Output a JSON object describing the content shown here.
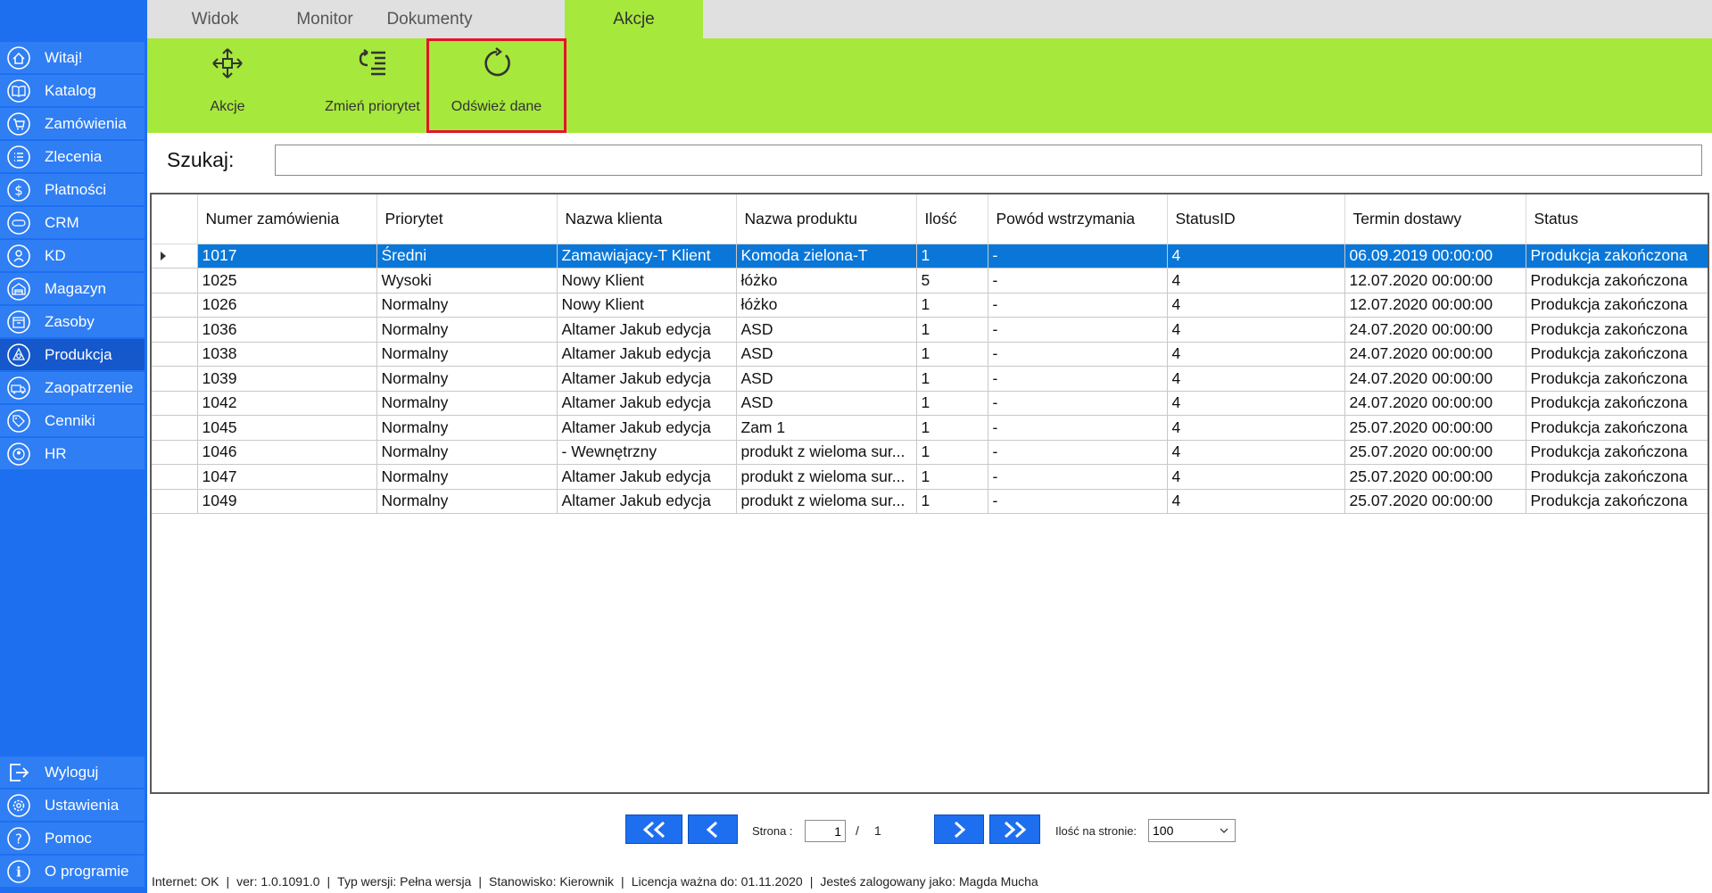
{
  "sidebar": {
    "items": [
      {
        "label": "Witaj!",
        "icon": "home-icon"
      },
      {
        "label": "Katalog",
        "icon": "book-icon"
      },
      {
        "label": "Zamówienia",
        "icon": "cart-icon"
      },
      {
        "label": "Zlecenia",
        "icon": "list-icon"
      },
      {
        "label": "Płatności",
        "icon": "dollar-icon"
      },
      {
        "label": "CRM",
        "icon": "crm-icon"
      },
      {
        "label": "KD",
        "icon": "person-icon"
      },
      {
        "label": "Magazyn",
        "icon": "warehouse-icon"
      },
      {
        "label": "Zasoby",
        "icon": "box-icon"
      },
      {
        "label": "Produkcja",
        "icon": "production-icon"
      },
      {
        "label": "Zaopatrzenie",
        "icon": "truck-icon"
      },
      {
        "label": "Cenniki",
        "icon": "tag-icon"
      },
      {
        "label": "HR",
        "icon": "hr-icon"
      }
    ],
    "active_item": "Produkcja",
    "bottom_items": [
      {
        "label": "Wyloguj",
        "icon": "logout-icon"
      },
      {
        "label": "Ustawienia",
        "icon": "settings-icon"
      },
      {
        "label": "Pomoc",
        "icon": "help-icon"
      },
      {
        "label": "O programie",
        "icon": "info-icon"
      }
    ]
  },
  "tabs": [
    {
      "label": "Widok"
    },
    {
      "label": "Monitor"
    },
    {
      "label": "Dokumenty"
    },
    {
      "label": "Akcje"
    }
  ],
  "active_tab": "Akcje",
  "ribbon": {
    "actions_label": "Akcje",
    "priority_label": "Zmień priorytet",
    "refresh_label": "Odśwież dane"
  },
  "search": {
    "label": "Szukaj:",
    "value": ""
  },
  "table": {
    "columns": [
      "Numer zamówienia",
      "Priorytet",
      "Nazwa klienta",
      "Nazwa produktu",
      "Ilość",
      "Powód wstrzymania",
      "StatusID",
      "Termin dostawy",
      "Status"
    ],
    "rows": [
      [
        "1017",
        "Średni",
        "Zamawiajacy-T Klient",
        "Komoda zielona-T",
        "1",
        "-",
        "4",
        "06.09.2019 00:00:00",
        "Produkcja zakończona"
      ],
      [
        "1025",
        "Wysoki",
        "Nowy Klient",
        "łóżko",
        "5",
        "-",
        "4",
        "12.07.2020 00:00:00",
        "Produkcja zakończona"
      ],
      [
        "1026",
        "Normalny",
        "Nowy Klient",
        "łóżko",
        "1",
        "-",
        "4",
        "12.07.2020 00:00:00",
        "Produkcja zakończona"
      ],
      [
        "1036",
        "Normalny",
        "Altamer Jakub edycja",
        "ASD",
        "1",
        "-",
        "4",
        "24.07.2020 00:00:00",
        "Produkcja zakończona"
      ],
      [
        "1038",
        "Normalny",
        "Altamer Jakub edycja",
        "ASD",
        "1",
        "-",
        "4",
        "24.07.2020 00:00:00",
        "Produkcja zakończona"
      ],
      [
        "1039",
        "Normalny",
        "Altamer Jakub edycja",
        "ASD",
        "1",
        "-",
        "4",
        "24.07.2020 00:00:00",
        "Produkcja zakończona"
      ],
      [
        "1042",
        "Normalny",
        "Altamer Jakub edycja",
        "ASD",
        "1",
        "-",
        "4",
        "24.07.2020 00:00:00",
        "Produkcja zakończona"
      ],
      [
        "1045",
        "Normalny",
        "Altamer Jakub edycja",
        "Zam 1",
        "1",
        "-",
        "4",
        "25.07.2020 00:00:00",
        "Produkcja zakończona"
      ],
      [
        "1046",
        "Normalny",
        "- Wewnętrzny",
        "produkt z wieloma sur...",
        "1",
        "-",
        "4",
        "25.07.2020 00:00:00",
        "Produkcja zakończona"
      ],
      [
        "1047",
        "Normalny",
        "Altamer Jakub edycja",
        "produkt z wieloma sur...",
        "1",
        "-",
        "4",
        "25.07.2020 00:00:00",
        "Produkcja zakończona"
      ],
      [
        "1049",
        "Normalny",
        "Altamer Jakub edycja",
        "produkt z wieloma sur...",
        "1",
        "-",
        "4",
        "25.07.2020 00:00:00",
        "Produkcja zakończona"
      ]
    ],
    "selected_row": 0
  },
  "pager": {
    "page_label": "Strona :",
    "current_page": "1",
    "separator": "/",
    "total_pages": "1",
    "per_page_label": "Ilość na stronie:",
    "per_page_value": "100"
  },
  "status_bar": {
    "internet": "Internet: OK",
    "version": "ver: 1.0.1091.0",
    "version_type": "Typ wersji: Pełna wersja",
    "position": "Stanowisko: Kierownik",
    "license": "Licencja ważna do: 01.11.2020",
    "user": "Jesteś zalogowany jako: Magda Mucha"
  },
  "colors": {
    "sidebar_bg": "#1e6ff0",
    "sidebar_item": "#2f7ef4",
    "ribbon_green": "#a6e83c",
    "selection_blue": "#0a77d8",
    "highlight_red": "#e5132a"
  }
}
